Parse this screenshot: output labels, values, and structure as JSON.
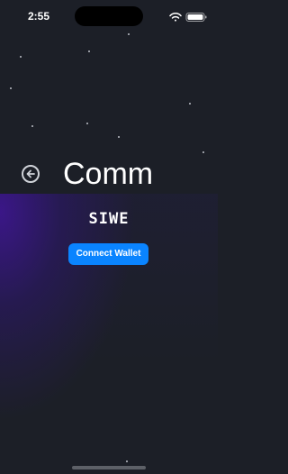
{
  "status_bar": {
    "time": "2:55",
    "icons": [
      "wifi-icon",
      "battery-icon"
    ]
  },
  "header": {
    "back_icon": "back-arrow-icon",
    "title": "Comm"
  },
  "main": {
    "siwe_label": "SIWE",
    "connect_button_label": "Connect Wallet"
  },
  "colors": {
    "background": "#1c1f27",
    "accent": "#0a84ff",
    "glow": "#3c168c"
  }
}
